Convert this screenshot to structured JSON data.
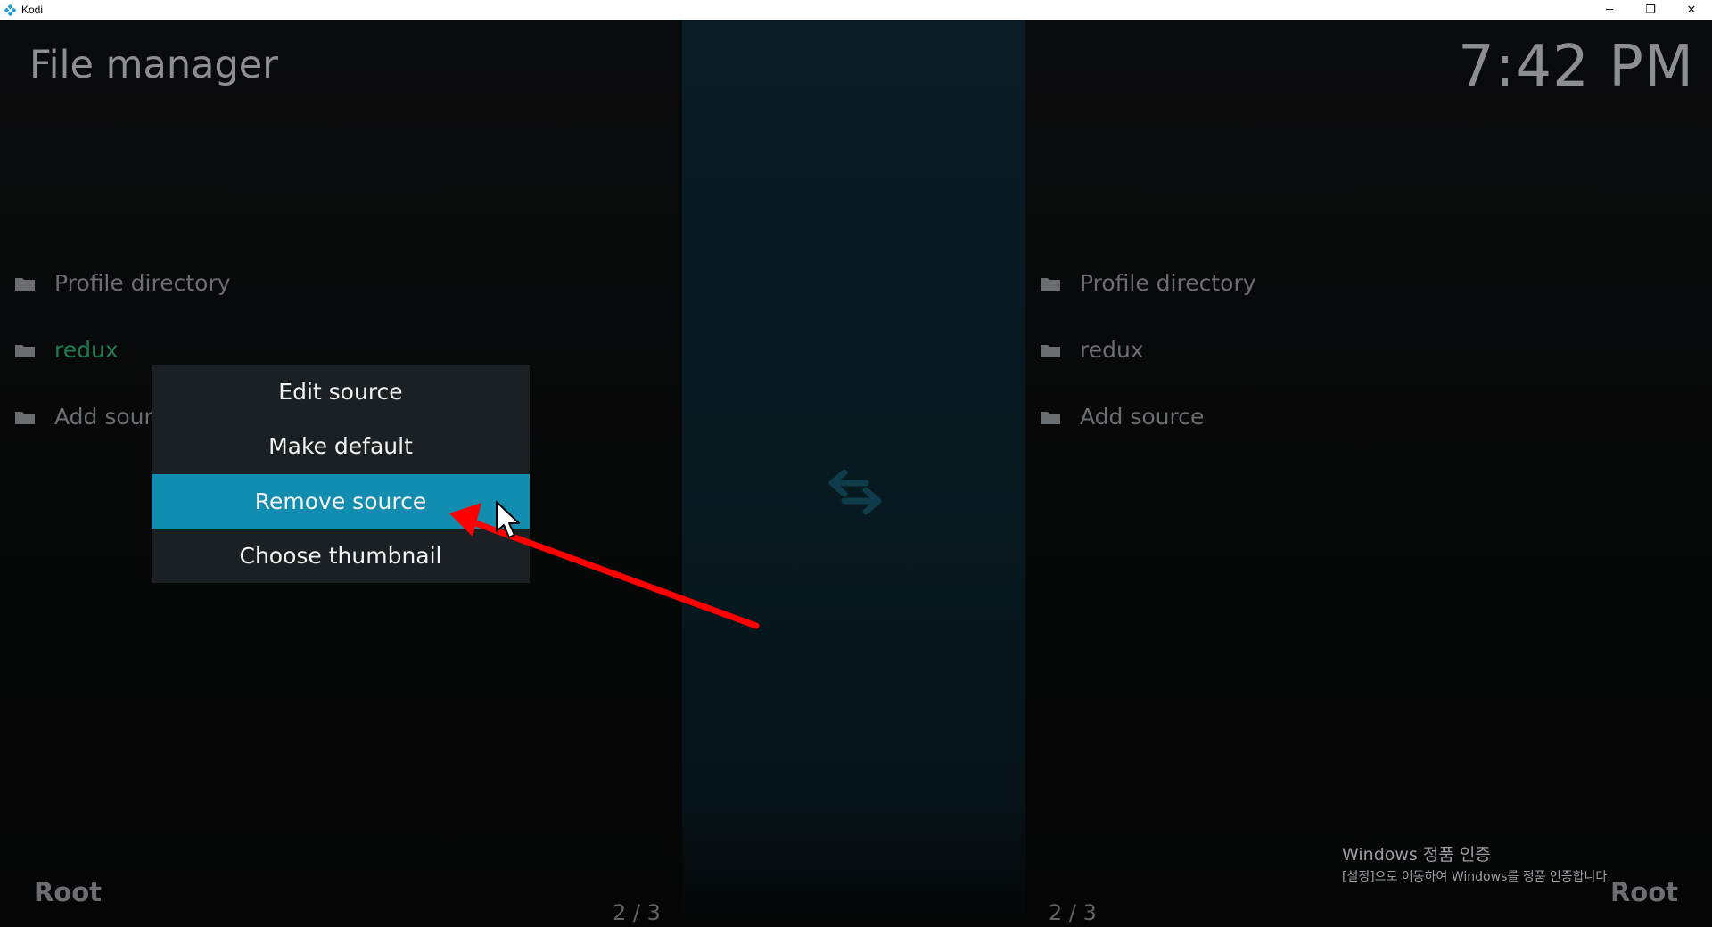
{
  "window": {
    "title": "Kodi",
    "controls": {
      "minimize": "─",
      "restore": "❐",
      "close": "✕"
    }
  },
  "header": {
    "title": "File manager",
    "clock": "7:42 PM"
  },
  "left_pane": {
    "items": [
      {
        "label": "Profile directory"
      },
      {
        "label": "redux"
      },
      {
        "label": "Add source"
      }
    ],
    "footer_label": "Root",
    "page_count": "2 / 3"
  },
  "right_pane": {
    "items": [
      {
        "label": "Profile directory"
      },
      {
        "label": "redux"
      },
      {
        "label": "Add source"
      }
    ],
    "footer_label": "Root",
    "page_count": "2 / 3"
  },
  "context_menu": {
    "items": [
      {
        "label": "Edit source"
      },
      {
        "label": "Make default"
      },
      {
        "label": "Remove source"
      },
      {
        "label": "Choose thumbnail"
      }
    ],
    "selected_index": 2
  },
  "activation_notice": {
    "line1": "Windows 정품 인증",
    "line2": "[설정]으로 이동하여 Windows를 정품 인증합니다."
  },
  "colors": {
    "accent": "#128db0",
    "active_item": "#1f7a52",
    "annotation_arrow": "#ff0000"
  }
}
